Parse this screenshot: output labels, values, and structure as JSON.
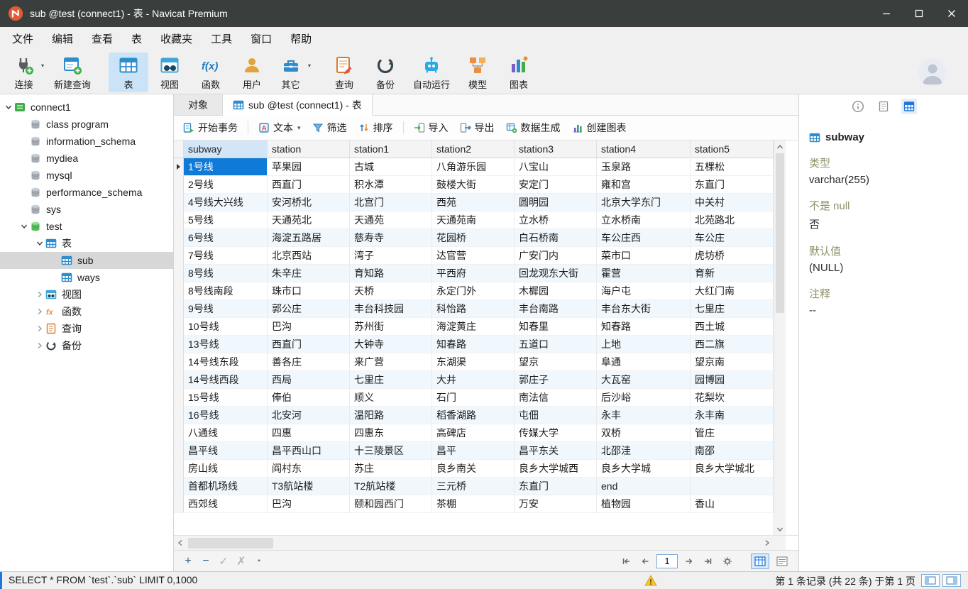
{
  "colors": {
    "accent": "#1e78d7",
    "selection": "#0f7ad8",
    "titlebar": "#3a3f3d",
    "warning": "#f5c33b",
    "toolbar_active": "#cbe3f7"
  },
  "window": {
    "title": "sub @test (connect1) - 表 - Navicat Premium"
  },
  "menubar": {
    "items": [
      "文件",
      "编辑",
      "查看",
      "表",
      "收藏夹",
      "工具",
      "窗口",
      "帮助"
    ]
  },
  "toolbar": {
    "buttons": [
      {
        "label": "连接",
        "icon": "plug",
        "dropdown": true,
        "active": false
      },
      {
        "label": "新建查询",
        "icon": "new-query",
        "dropdown": false,
        "active": false
      },
      {
        "label": "表",
        "icon": "table",
        "dropdown": false,
        "active": true
      },
      {
        "label": "视图",
        "icon": "view",
        "dropdown": false,
        "active": false
      },
      {
        "label": "函数",
        "icon": "function",
        "dropdown": false,
        "active": false
      },
      {
        "label": "用户",
        "icon": "user",
        "dropdown": false,
        "active": false
      },
      {
        "label": "其它",
        "icon": "toolbox",
        "dropdown": true,
        "active": false
      },
      {
        "label": "查询",
        "icon": "query",
        "dropdown": false,
        "active": false
      },
      {
        "label": "备份",
        "icon": "backup",
        "dropdown": false,
        "active": false
      },
      {
        "label": "自动运行",
        "icon": "automation",
        "dropdown": false,
        "active": false
      },
      {
        "label": "模型",
        "icon": "model",
        "dropdown": false,
        "active": false
      },
      {
        "label": "图表",
        "icon": "charts",
        "dropdown": false,
        "active": false
      }
    ]
  },
  "sidebar": {
    "tree": [
      {
        "label": "connect1",
        "level": 0,
        "icon": "connection",
        "expander": "expanded",
        "selected": false
      },
      {
        "label": "class program",
        "level": 1,
        "icon": "database",
        "expander": "none",
        "selected": false
      },
      {
        "label": "information_schema",
        "level": 1,
        "icon": "database",
        "expander": "none",
        "selected": false
      },
      {
        "label": "mydiea",
        "level": 1,
        "icon": "database",
        "expander": "none",
        "selected": false
      },
      {
        "label": "mysql",
        "level": 1,
        "icon": "database",
        "expander": "none",
        "selected": false
      },
      {
        "label": "performance_schema",
        "level": 1,
        "icon": "database",
        "expander": "none",
        "selected": false
      },
      {
        "label": "sys",
        "level": 1,
        "icon": "database",
        "expander": "none",
        "selected": false
      },
      {
        "label": "test",
        "level": 1,
        "icon": "database-open",
        "expander": "expanded",
        "selected": false
      },
      {
        "label": "表",
        "level": 2,
        "icon": "tables",
        "expander": "expanded",
        "selected": false
      },
      {
        "label": "sub",
        "level": 3,
        "icon": "table-small",
        "expander": "none",
        "selected": true
      },
      {
        "label": "ways",
        "level": 3,
        "icon": "table-small",
        "expander": "none",
        "selected": false
      },
      {
        "label": "视图",
        "level": 2,
        "icon": "view-small",
        "expander": "collapsed",
        "selected": false
      },
      {
        "label": "函数",
        "level": 2,
        "icon": "function-small",
        "expander": "collapsed",
        "selected": false
      },
      {
        "label": "查询",
        "level": 2,
        "icon": "query-small",
        "expander": "collapsed",
        "selected": false
      },
      {
        "label": "备份",
        "level": 2,
        "icon": "backup-small",
        "expander": "collapsed",
        "selected": false
      }
    ]
  },
  "tabs": [
    {
      "label": "对象",
      "icon": null,
      "active": false
    },
    {
      "label": "sub @test (connect1) - 表",
      "icon": "table-small",
      "active": true
    }
  ],
  "data_toolbar": {
    "items": [
      {
        "label": "开始事务",
        "icon": "transaction",
        "dropdown": false
      },
      {
        "label": "文本",
        "icon": "text-format",
        "dropdown": true
      },
      {
        "label": "筛选",
        "icon": "filter",
        "dropdown": false
      },
      {
        "label": "排序",
        "icon": "sort",
        "dropdown": false
      },
      {
        "label": "导入",
        "icon": "import",
        "dropdown": false
      },
      {
        "label": "导出",
        "icon": "export",
        "dropdown": false
      },
      {
        "label": "数据生成",
        "icon": "datagen",
        "dropdown": false
      },
      {
        "label": "创建图表",
        "icon": "chart",
        "dropdown": false
      }
    ]
  },
  "grid": {
    "columns": [
      "subway",
      "station",
      "station1",
      "station2",
      "station3",
      "station4",
      "station5"
    ],
    "selected_column": "subway",
    "selected_cell": {
      "row": 0,
      "col": 0
    },
    "rows": [
      [
        "1号线",
        "苹果园",
        "古城",
        "八角游乐园",
        "八宝山",
        "玉泉路",
        "五棵松"
      ],
      [
        "2号线",
        "西直门",
        "积水潭",
        "鼓楼大街",
        "安定门",
        "雍和宫",
        "东直门"
      ],
      [
        "4号线大兴线",
        "安河桥北",
        "北宫门",
        "西苑",
        "圆明园",
        "北京大学东门",
        "中关村"
      ],
      [
        "5号线",
        "天通苑北",
        "天通苑",
        "天通苑南",
        "立水桥",
        "立水桥南",
        "北苑路北"
      ],
      [
        "6号线",
        "海淀五路居",
        "慈寿寺",
        "花园桥",
        "白石桥南",
        "车公庄西",
        "车公庄"
      ],
      [
        "7号线",
        "北京西站",
        "湾子",
        "达官营",
        "广安门内",
        "菜市口",
        "虎坊桥"
      ],
      [
        "8号线",
        "朱辛庄",
        "育知路",
        "平西府",
        "回龙观东大街",
        "霍营",
        "育新"
      ],
      [
        "8号线南段",
        "珠市口",
        "天桥",
        "永定门外",
        "木樨园",
        "海户屯",
        "大红门南"
      ],
      [
        "9号线",
        "郭公庄",
        "丰台科技园",
        "科怡路",
        "丰台南路",
        "丰台东大街",
        "七里庄"
      ],
      [
        "10号线",
        "巴沟",
        "苏州街",
        "海淀黄庄",
        "知春里",
        "知春路",
        "西土城"
      ],
      [
        "13号线",
        "西直门",
        "大钟寺",
        "知春路",
        "五道口",
        "上地",
        "西二旗"
      ],
      [
        "14号线东段",
        "善各庄",
        "来广营",
        "东湖渠",
        "望京",
        "阜通",
        "望京南"
      ],
      [
        "14号线西段",
        "西局",
        "七里庄",
        "大井",
        "郭庄子",
        "大瓦窑",
        "园博园"
      ],
      [
        "15号线",
        "俸伯",
        "顺义",
        "石门",
        "南法信",
        "后沙峪",
        "花梨坎"
      ],
      [
        "16号线",
        "北安河",
        "温阳路",
        "稻香湖路",
        "屯佃",
        "永丰",
        "永丰南"
      ],
      [
        "八通线",
        "四惠",
        "四惠东",
        "高碑店",
        "传媒大学",
        "双桥",
        "管庄"
      ],
      [
        "昌平线",
        "昌平西山口",
        "十三陵景区",
        "昌平",
        "昌平东关",
        "北邵洼",
        "南邵"
      ],
      [
        "房山线",
        "阎村东",
        "苏庄",
        "良乡南关",
        "良乡大学城西",
        "良乡大学城",
        "良乡大学城北"
      ],
      [
        "首都机场线",
        "T3航站楼",
        "T2航站楼",
        "三元桥",
        "东直门",
        "end",
        ""
      ],
      [
        "西郊线",
        "巴沟",
        "颐和园西门",
        "茶棚",
        "万安",
        "植物园",
        "香山"
      ]
    ]
  },
  "pagination": {
    "page": "1"
  },
  "status_bar": {
    "query": "SELECT * FROM `test`.`sub` LIMIT 0,1000",
    "record_info": "第 1 条记录 (共 22 条) 于第 1 页"
  },
  "right_panel": {
    "object_name": "subway",
    "fields": [
      {
        "label": "类型",
        "value": "varchar(255)"
      },
      {
        "label": "不是 null",
        "value": "否"
      },
      {
        "label": "默认值",
        "value": "(NULL)"
      },
      {
        "label": "注释",
        "value": "--"
      }
    ]
  }
}
